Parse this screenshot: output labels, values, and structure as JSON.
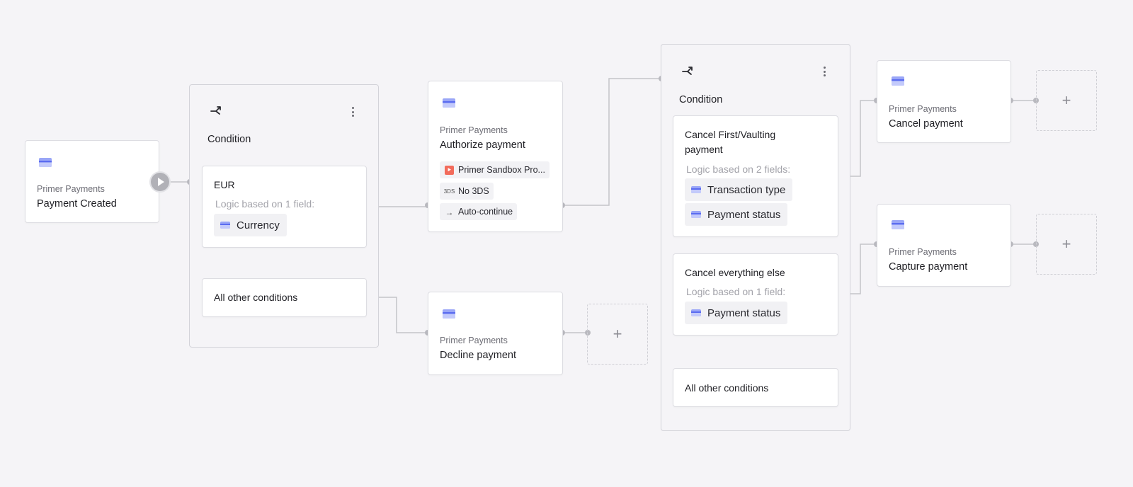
{
  "trigger": {
    "provider": "Primer Payments",
    "title": "Payment Created",
    "icon": "primer-payments-icon"
  },
  "condition_1": {
    "title": "Condition",
    "icon": "branch-icon",
    "branches": [
      {
        "title": "EUR",
        "logic": "Logic based on 1 field:",
        "fields": [
          "Currency"
        ]
      },
      {
        "title": "All other conditions"
      }
    ]
  },
  "authorize": {
    "provider": "Primer Payments",
    "title": "Authorize payment",
    "tags": [
      "Primer Sandbox Pro...",
      "No 3DS",
      "Auto-continue"
    ]
  },
  "decline": {
    "provider": "Primer Payments",
    "title": "Decline payment"
  },
  "condition_2": {
    "title": "Condition",
    "icon": "branch-icon",
    "branches": [
      {
        "title_line1": "Cancel First/Vaulting",
        "title_line2": "payment",
        "logic": "Logic based on 2 fields:",
        "fields": [
          "Transaction type",
          "Payment status"
        ]
      },
      {
        "title": "Cancel everything else",
        "logic": "Logic based on 1 field:",
        "fields": [
          "Payment status"
        ]
      },
      {
        "title": "All other conditions"
      }
    ]
  },
  "cancel": {
    "provider": "Primer Payments",
    "title": "Cancel payment"
  },
  "capture": {
    "provider": "Primer Payments",
    "title": "Capture payment"
  },
  "add_step_label": "+",
  "colors": {
    "canvas": "#f5f4f7",
    "app_icon": "#5b6cf0",
    "processor_tag": "#f26b5b",
    "connector": "#c4c4c9"
  }
}
